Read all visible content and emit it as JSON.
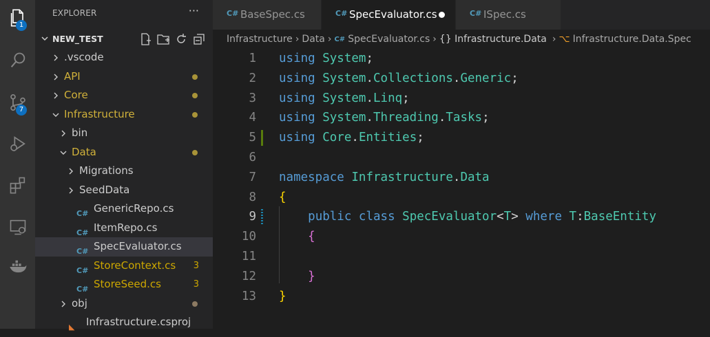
{
  "activity_bar": {
    "explorer_badge": "1",
    "source_control_badge": "7"
  },
  "sidebar": {
    "title": "EXPLORER",
    "more": "···",
    "folder_name": "NEW_TEST",
    "tree": [
      {
        "label": ".vscode",
        "type": "folder",
        "expanded": false,
        "depth": 0,
        "status": "none"
      },
      {
        "label": "API",
        "type": "folder",
        "expanded": false,
        "depth": 0,
        "status": "modified",
        "dot": true
      },
      {
        "label": "Core",
        "type": "folder",
        "expanded": false,
        "depth": 0,
        "status": "modified",
        "dot": true
      },
      {
        "label": "Infrastructure",
        "type": "folder",
        "expanded": true,
        "depth": 0,
        "status": "modified",
        "dot": true
      },
      {
        "label": "bin",
        "type": "folder",
        "expanded": false,
        "depth": 1,
        "status": "none"
      },
      {
        "label": "Data",
        "type": "folder",
        "expanded": true,
        "depth": 1,
        "status": "modified",
        "dot": true
      },
      {
        "label": "Migrations",
        "type": "folder",
        "expanded": false,
        "depth": 2,
        "status": "none"
      },
      {
        "label": "SeedData",
        "type": "folder",
        "expanded": false,
        "depth": 2,
        "status": "none"
      },
      {
        "label": "GenericRepo.cs",
        "type": "cs",
        "depth": 2,
        "status": "none"
      },
      {
        "label": "ItemRepo.cs",
        "type": "cs",
        "depth": 2,
        "status": "none"
      },
      {
        "label": "SpecEvaluator.cs",
        "type": "cs",
        "depth": 2,
        "status": "none",
        "selected": true
      },
      {
        "label": "StoreContext.cs",
        "type": "cs",
        "depth": 2,
        "status": "warning",
        "count": "3"
      },
      {
        "label": "StoreSeed.cs",
        "type": "cs",
        "depth": 2,
        "status": "warning",
        "count": "3"
      },
      {
        "label": "obj",
        "type": "folder",
        "expanded": false,
        "depth": 1,
        "status": "none",
        "dot": true,
        "dot_gray": true
      },
      {
        "label": "Infrastructure.csproj",
        "type": "rss",
        "depth": 1,
        "status": "none"
      }
    ]
  },
  "tabs": [
    {
      "label": "BaseSpec.cs",
      "active": false,
      "dirty": false
    },
    {
      "label": "SpecEvaluator.cs",
      "active": true,
      "dirty": true
    },
    {
      "label": "ISpec.cs",
      "active": false,
      "dirty": false
    }
  ],
  "breadcrumbs": {
    "items": [
      "Infrastructure",
      "Data",
      "SpecEvaluator.cs",
      "{} Infrastructure.Data",
      "Infrastructure.Data.Spec"
    ]
  },
  "code": {
    "lines": [
      {
        "n": "1",
        "tokens": [
          [
            "kw",
            "using"
          ],
          [
            "pl",
            " "
          ],
          [
            "ns2",
            "System"
          ],
          [
            "pl",
            ";"
          ]
        ]
      },
      {
        "n": "2",
        "tokens": [
          [
            "kw",
            "using"
          ],
          [
            "pl",
            " "
          ],
          [
            "ns2",
            "System"
          ],
          [
            "pl",
            "."
          ],
          [
            "ns2",
            "Collections"
          ],
          [
            "pl",
            "."
          ],
          [
            "ns2",
            "Generic"
          ],
          [
            "pl",
            ";"
          ]
        ]
      },
      {
        "n": "3",
        "tokens": [
          [
            "kw",
            "using"
          ],
          [
            "pl",
            " "
          ],
          [
            "ns2",
            "System"
          ],
          [
            "pl",
            "."
          ],
          [
            "ns2",
            "Linq"
          ],
          [
            "pl",
            ";"
          ]
        ]
      },
      {
        "n": "4",
        "tokens": [
          [
            "kw",
            "using"
          ],
          [
            "pl",
            " "
          ],
          [
            "ns2",
            "System"
          ],
          [
            "pl",
            "."
          ],
          [
            "ns2",
            "Threading"
          ],
          [
            "pl",
            "."
          ],
          [
            "ns2",
            "Tasks"
          ],
          [
            "pl",
            ";"
          ]
        ]
      },
      {
        "n": "5",
        "mark": "add",
        "tokens": [
          [
            "kw",
            "using"
          ],
          [
            "pl",
            " "
          ],
          [
            "ns2",
            "Core"
          ],
          [
            "pl",
            "."
          ],
          [
            "ns2",
            "Entities"
          ],
          [
            "pl",
            ";"
          ]
        ]
      },
      {
        "n": "6",
        "tokens": []
      },
      {
        "n": "7",
        "tokens": [
          [
            "kw",
            "namespace"
          ],
          [
            "pl",
            " "
          ],
          [
            "ns2",
            "Infrastructure"
          ],
          [
            "pl",
            "."
          ],
          [
            "ns2",
            "Data"
          ]
        ]
      },
      {
        "n": "8",
        "tokens": [
          [
            "br1",
            "{"
          ]
        ]
      },
      {
        "n": "9",
        "current": true,
        "mark": "mod",
        "tokens": [
          [
            "pl",
            "    "
          ],
          [
            "kw",
            "public"
          ],
          [
            "pl",
            " "
          ],
          [
            "kw",
            "class"
          ],
          [
            "pl",
            " "
          ],
          [
            "ns2",
            "SpecEvaluator"
          ],
          [
            "pl",
            "<"
          ],
          [
            "ns2",
            "T"
          ],
          [
            "pl",
            "> "
          ],
          [
            "kw",
            "where"
          ],
          [
            "pl",
            " "
          ],
          [
            "ns2",
            "T"
          ],
          [
            "pl",
            ":"
          ],
          [
            "ns2",
            "BaseEntity"
          ]
        ]
      },
      {
        "n": "10",
        "tokens": [
          [
            "pl",
            "    "
          ],
          [
            "br2",
            "{"
          ]
        ]
      },
      {
        "n": "11",
        "tokens": []
      },
      {
        "n": "12",
        "tokens": [
          [
            "pl",
            "    "
          ],
          [
            "br2",
            "}"
          ]
        ]
      },
      {
        "n": "13",
        "tokens": [
          [
            "br1",
            "}"
          ]
        ]
      }
    ]
  },
  "colors": {
    "modified": "#d0b13a",
    "warning": "#cca700",
    "keyword": "#569cd6",
    "type": "#4ec9b0"
  }
}
